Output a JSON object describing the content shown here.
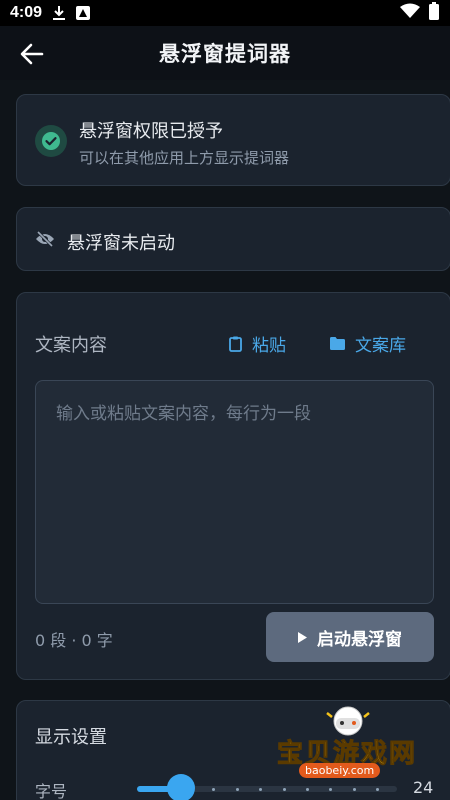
{
  "status_bar": {
    "time": "4:09"
  },
  "app_bar": {
    "title": "悬浮窗提词器"
  },
  "permission": {
    "title": "悬浮窗权限已授予",
    "subtitle": "可以在其他应用上方显示提词器",
    "icon": "check-circle-icon",
    "color": "#3fb98f"
  },
  "float_status": {
    "text": "悬浮窗未启动",
    "icon": "eye-off-icon"
  },
  "content": {
    "label": "文案内容",
    "paste_label": "粘贴",
    "library_label": "文案库",
    "placeholder": "输入或粘贴文案内容，每行为一段",
    "value": "",
    "count": "0 段 · 0 字",
    "start_label": "启动悬浮窗"
  },
  "settings": {
    "title": "显示设置",
    "font_size_label": "字号",
    "font_size_value": "24",
    "font_size_fraction": 0.17
  },
  "watermark": {
    "text": "宝贝游戏网",
    "url": "baobeiy.com"
  },
  "colors": {
    "accent": "#3aa6f0",
    "background": "#0f1419",
    "card": "#1b232e"
  }
}
